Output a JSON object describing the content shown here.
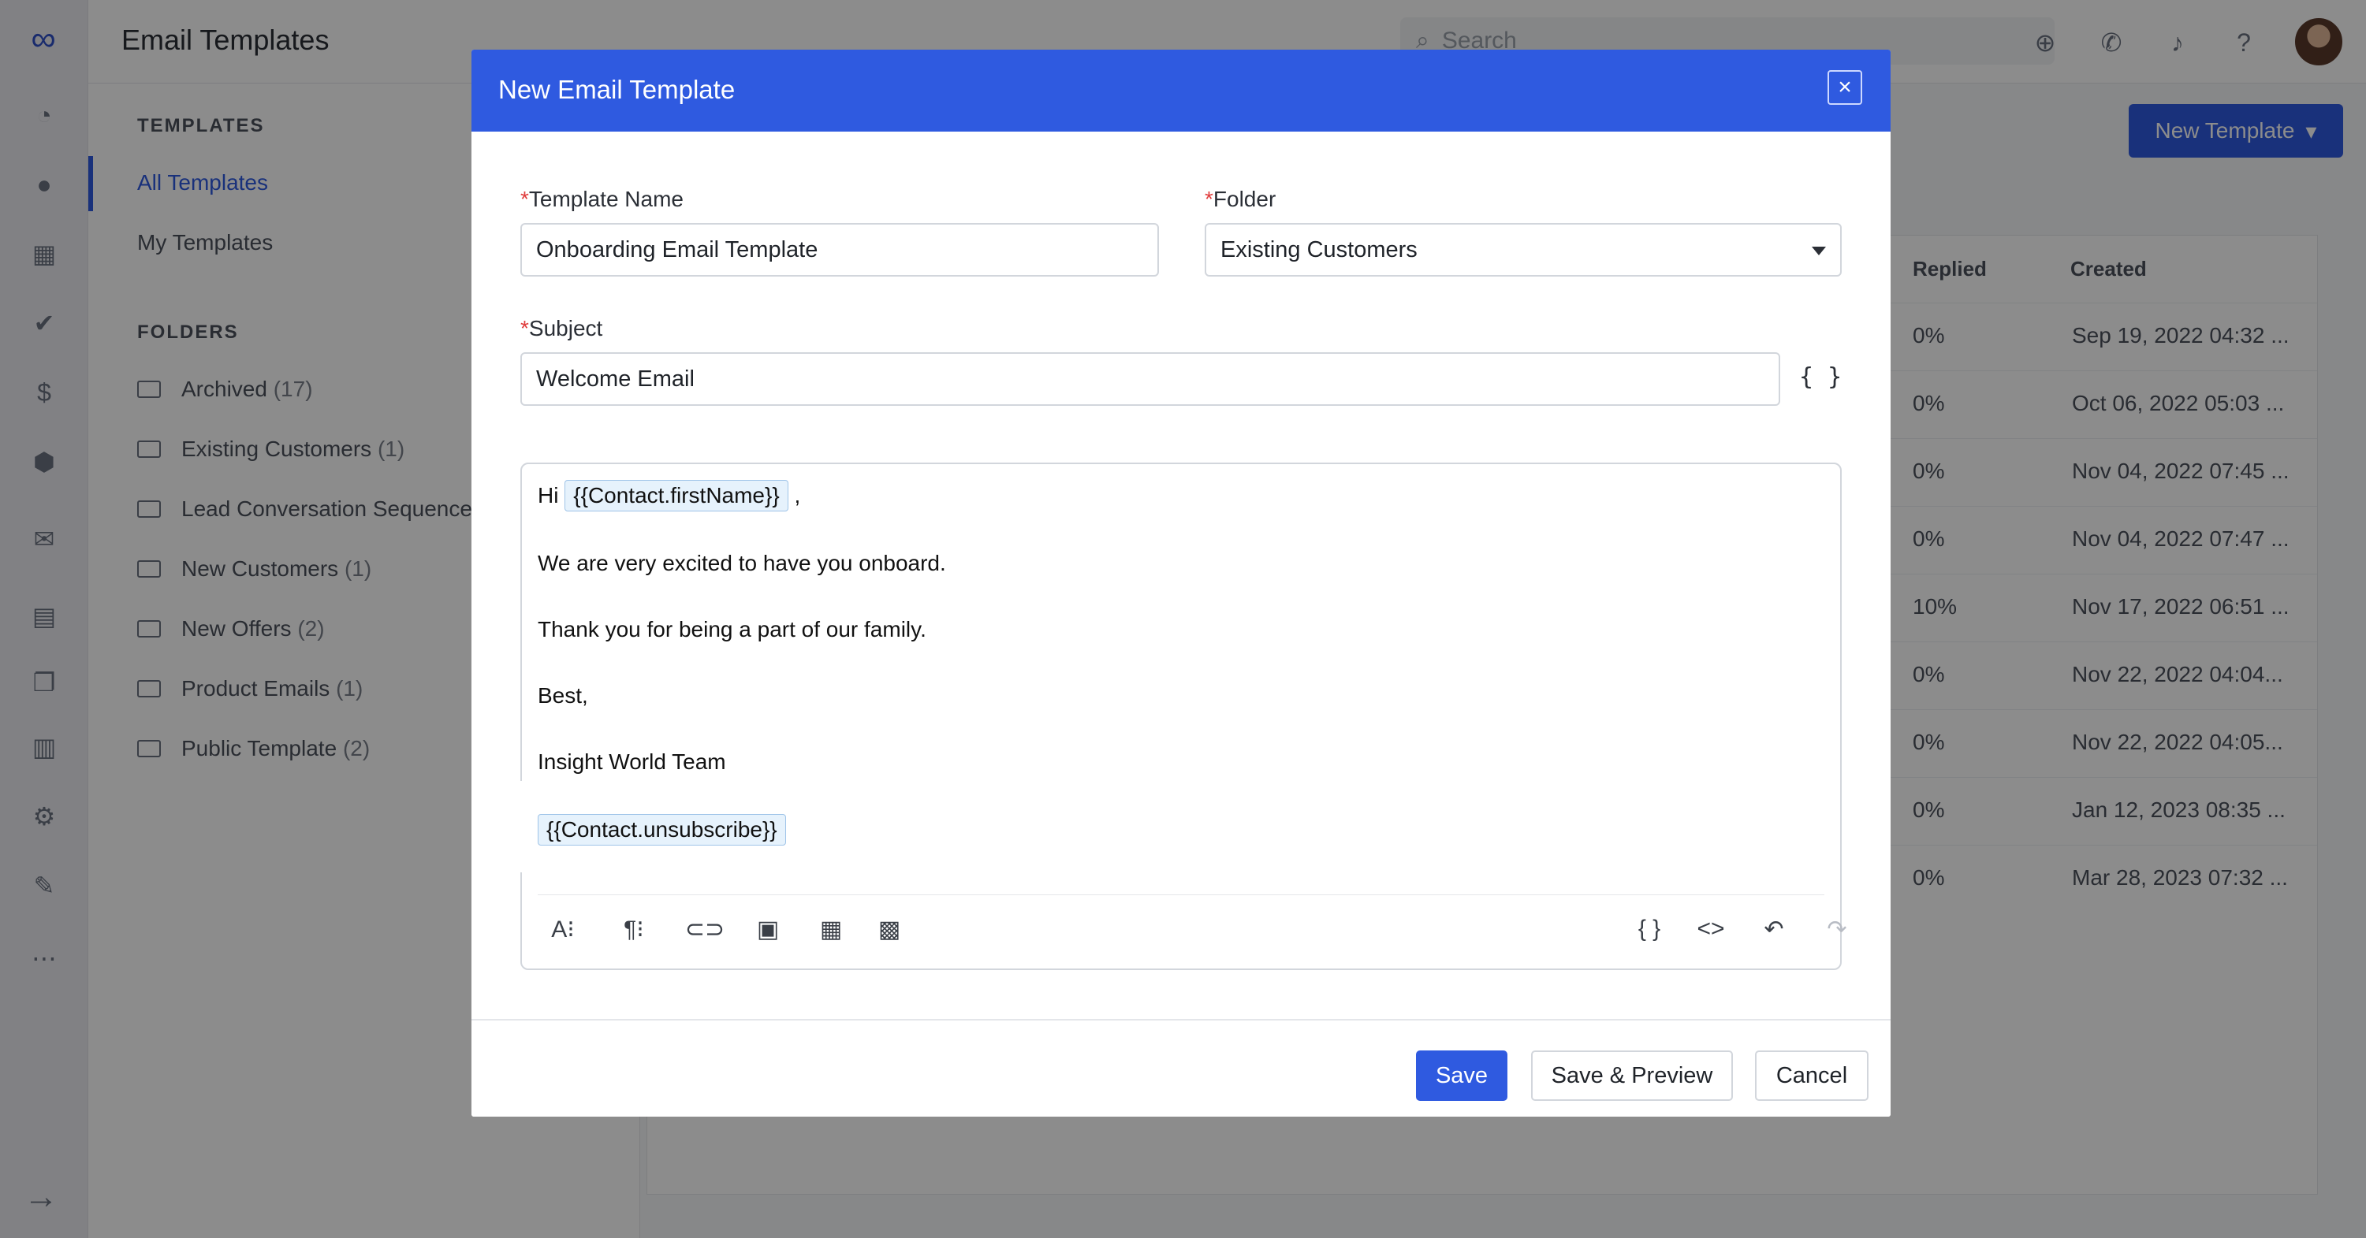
{
  "app": {
    "page_title": "Email Templates",
    "search_placeholder": "Search",
    "new_template_label": "New Template",
    "left_rail_icons": [
      "dashboard-icon",
      "contacts-icon",
      "building-icon",
      "deals-icon",
      "dollar-icon",
      "box-icon",
      "mail-icon",
      "inbox-icon",
      "documents-icon",
      "reports-icon",
      "settings-icon",
      "chat-icon",
      "more-icon"
    ],
    "topbar_icons": [
      "add-circle-icon",
      "phone-icon",
      "bell-icon",
      "help-icon"
    ]
  },
  "templates_panel": {
    "section_label": "TEMPLATES",
    "items": [
      {
        "label": "All Templates",
        "active": true
      },
      {
        "label": "My Templates",
        "active": false
      }
    ]
  },
  "folders_panel": {
    "section_label": "FOLDERS",
    "items": [
      {
        "name": "Archived",
        "count": "(17)"
      },
      {
        "name": "Existing Customers",
        "count": "(1)"
      },
      {
        "name": "Lead Conversation Sequence",
        "count": ""
      },
      {
        "name": "New Customers",
        "count": "(1)"
      },
      {
        "name": "New Offers",
        "count": "(2)"
      },
      {
        "name": "Product Emails",
        "count": "(1)"
      },
      {
        "name": "Public Template",
        "count": "(2)"
      }
    ]
  },
  "table": {
    "columns": [
      "Replied",
      "Created"
    ],
    "rows": [
      {
        "replied": "0%",
        "created": "Sep 19, 2022 04:32 ..."
      },
      {
        "replied": "0%",
        "created": "Oct 06, 2022 05:03 ..."
      },
      {
        "replied": "0%",
        "created": "Nov 04, 2022 07:45 ..."
      },
      {
        "replied": "0%",
        "created": "Nov 04, 2022 07:47 ..."
      },
      {
        "replied": "10%",
        "created": "Nov 17, 2022 06:51 ..."
      },
      {
        "replied": "0%",
        "created": "Nov 22, 2022 04:04..."
      },
      {
        "replied": "0%",
        "created": "Nov 22, 2022 04:05..."
      },
      {
        "replied": "0%",
        "created": "Jan 12, 2023 08:35 ..."
      },
      {
        "replied": "0%",
        "created": "Mar 28, 2023 07:32 ..."
      }
    ]
  },
  "modal": {
    "title": "New Email Template",
    "required_mark": "*",
    "template_name": {
      "label": "Template Name",
      "value": "Onboarding Email Template"
    },
    "folder": {
      "label": "Folder",
      "value": "Existing Customers"
    },
    "subject": {
      "label": "Subject",
      "value": "Welcome Email",
      "merge_label": "{ }"
    },
    "body": {
      "greeting": "Hi",
      "first_name_tag": "{{Contact.firstName}}",
      "greeting_suffix": ",",
      "line1": "We are very excited to have you onboard.",
      "line2": "Thank you for being a part of our family.",
      "line3": "Best,",
      "line4": "Insight World Team",
      "unsubscribe_tag": "{{Contact.unsubscribe}}"
    },
    "toolbar": {
      "left": [
        "text-format-icon",
        "paragraph-icon",
        "link-icon",
        "image-icon",
        "table-icon",
        "calendar-icon"
      ],
      "right": [
        "merge-field-icon",
        "code-icon",
        "undo-icon",
        "redo-icon"
      ]
    },
    "buttons": {
      "save": "Save",
      "save_preview": "Save & Preview",
      "cancel": "Cancel"
    }
  },
  "colors": {
    "primary": "#2f5ae0",
    "required": "#e03c3c"
  }
}
